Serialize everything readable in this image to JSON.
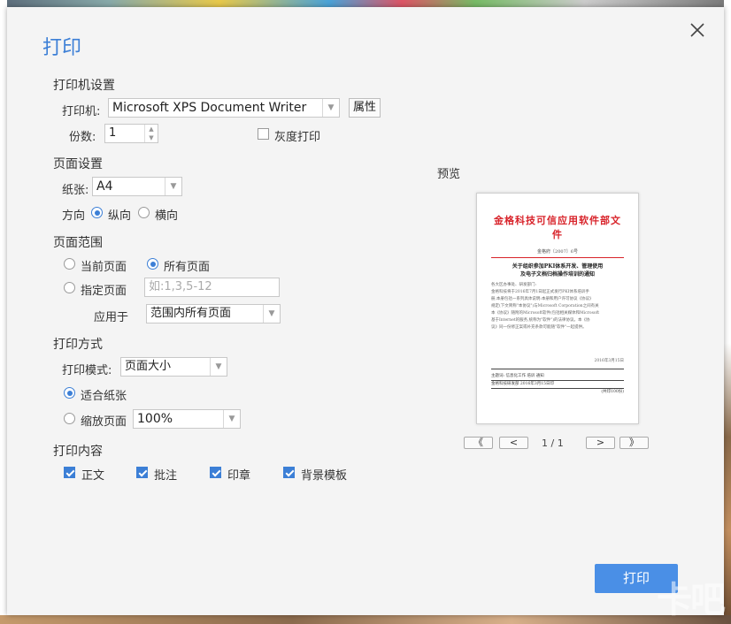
{
  "dialog": {
    "title": "打印",
    "printer_settings": {
      "section": "打印机设置",
      "printer_label": "打印机:",
      "printer_value": "Microsoft XPS Document Writer",
      "properties_label": "属性",
      "copies_label": "份数:",
      "copies_value": "1",
      "grayscale_label": "灰度打印",
      "grayscale_checked": false
    },
    "page_settings": {
      "section": "页面设置",
      "paper_label": "纸张:",
      "paper_value": "A4",
      "orientation_label": "方向",
      "portrait_label": "纵向",
      "landscape_label": "横向",
      "selected": "portrait"
    },
    "page_range": {
      "section": "页面范围",
      "current_label": "当前页面",
      "all_label": "所有页面",
      "specify_label": "指定页面",
      "specify_placeholder": "如:1,3,5-12",
      "apply_label": "应用于",
      "apply_value": "范围内所有页面",
      "selected": "all"
    },
    "print_mode": {
      "section": "打印方式",
      "mode_label": "打印模式:",
      "mode_value": "页面大小",
      "fit_label": "适合纸张",
      "scale_label": "缩放页面",
      "scale_value": "100%",
      "selected": "fit"
    },
    "print_content": {
      "section": "打印内容",
      "items": [
        {
          "label": "正文",
          "checked": true
        },
        {
          "label": "批注",
          "checked": true
        },
        {
          "label": "印章",
          "checked": true
        },
        {
          "label": "背景模板",
          "checked": true
        }
      ]
    },
    "preview": {
      "label": "预览",
      "doc_title": "金格科技可信应用软件部文件",
      "doc_no": "金格府〔2007〕6号",
      "doc_heading_1": "关于组织参加PKI体系开发、管理使用",
      "doc_heading_2": "及电子文档归档操作培训的通知",
      "doc_lines": [
        "各大区办事处、研发部门:",
        "金格科技将于2016年7月1日起正式发行PKI体系培训手",
        "册,本册包括一系列具体说明:本册和用户许可协议《协议》",
        "规定(下文简称\"本协议\")与Microsoft Corporation之间有关",
        "本《协议》随附的Microsoft软件(包括相关媒体和Microsoft",
        "基于Internet的服务,统称为\"软件\")的法律协议。本《协",
        "议》同一份修正案或补充条款可能随\"软件\"一起提供。"
      ],
      "doc_date": "2016年3月15日",
      "doc_footer_1": "主题词: 信息化工作  培训  通知",
      "doc_footer_2": "金格科技研发部          2016年3月15日印",
      "doc_footer_3": "(共印100份)",
      "page_indicator": "1 / 1",
      "first_label": "《",
      "prev_label": "<",
      "next_label": ">",
      "last_label": "》"
    },
    "print_button": "打印"
  },
  "watermark": "卡吧"
}
